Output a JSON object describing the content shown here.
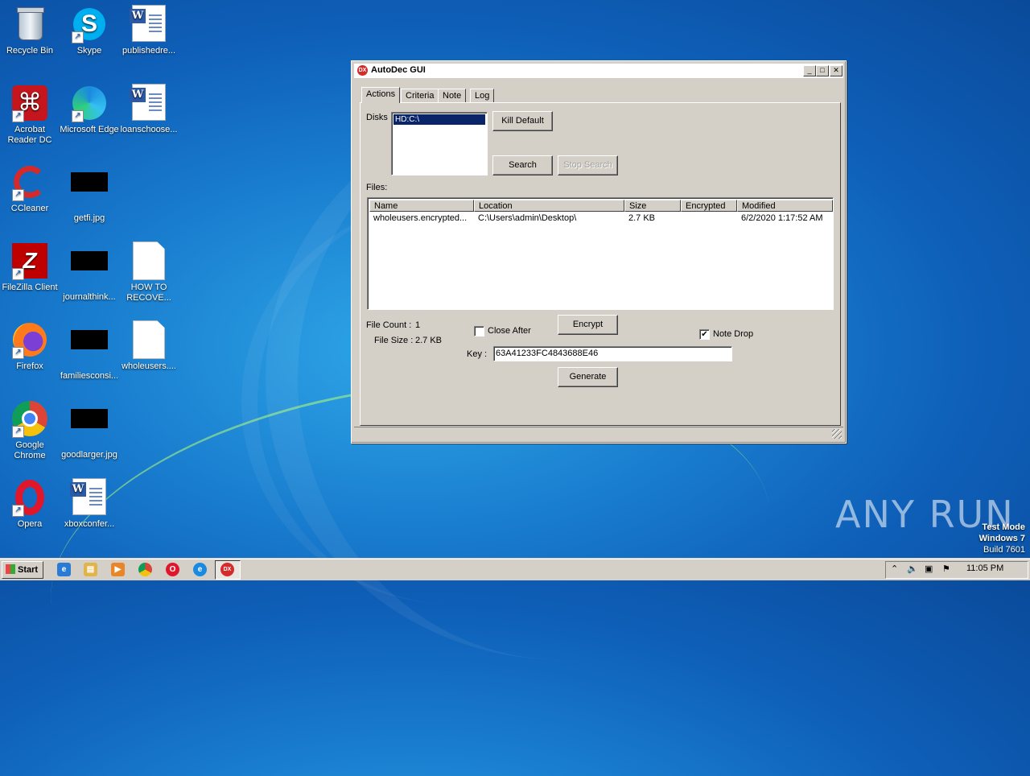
{
  "desktop": {
    "icons": [
      {
        "label": "Recycle Bin"
      },
      {
        "label": "Skype"
      },
      {
        "label": "publishedre..."
      },
      {
        "label": "Acrobat Reader DC"
      },
      {
        "label": "Microsoft Edge"
      },
      {
        "label": "loanschoose..."
      },
      {
        "label": "CCleaner"
      },
      {
        "label": "getfi.jpg"
      },
      {
        "label": "FileZilla Client"
      },
      {
        "label": "journalthink..."
      },
      {
        "label": "HOW TO RECOVE..."
      },
      {
        "label": "Firefox"
      },
      {
        "label": "familiesconsi..."
      },
      {
        "label": "wholeusers...."
      },
      {
        "label": "Google Chrome"
      },
      {
        "label": "goodlarger.jpg"
      },
      {
        "label": "Opera"
      },
      {
        "label": "xboxconfer..."
      }
    ],
    "watermark": "ANY RUN",
    "test_mode": {
      "line1": "Test Mode",
      "line2": "Windows 7",
      "line3": "Build 7601"
    }
  },
  "window": {
    "title": "AutoDec GUI",
    "app_icon_text": "DX",
    "title_buttons": {
      "minimize": "_",
      "maximize": "□",
      "close": "✕"
    },
    "tabs": [
      "Actions",
      "Criteria",
      "Note",
      "Log"
    ],
    "disks_label": "Disks",
    "disks": [
      "HD:C:\\"
    ],
    "buttons": {
      "kill_default": "Kill Default",
      "search": "Search",
      "stop_search": "Stop Search",
      "encrypt": "Encrypt",
      "generate": "Generate"
    },
    "files_label": "Files:",
    "columns": [
      "Name",
      "Location",
      "Size",
      "Encrypted",
      "Modified"
    ],
    "files": [
      {
        "name": "wholeusers.encrypted...",
        "location": "C:\\Users\\admin\\Desktop\\",
        "size": "2.7 KB",
        "encrypted": "",
        "modified": "6/2/2020 1:17:52 AM"
      }
    ],
    "file_count_label": "File Count :",
    "file_count": "1",
    "file_size_label": "File Size :",
    "file_size": "2.7 KB",
    "close_after_label": "Close After",
    "close_after_checked": false,
    "note_drop_label": "Note Drop",
    "note_drop_checked": true,
    "key_label": "Key :",
    "key_value": "63A41233FC4843688E46"
  },
  "taskbar": {
    "start_label": "Start",
    "pinned": [
      "internet-explorer-icon",
      "explorer-icon",
      "media-player-icon",
      "chrome-icon",
      "opera-icon",
      "edge-icon",
      "autodec-icon"
    ],
    "clock": "11:05 PM"
  }
}
